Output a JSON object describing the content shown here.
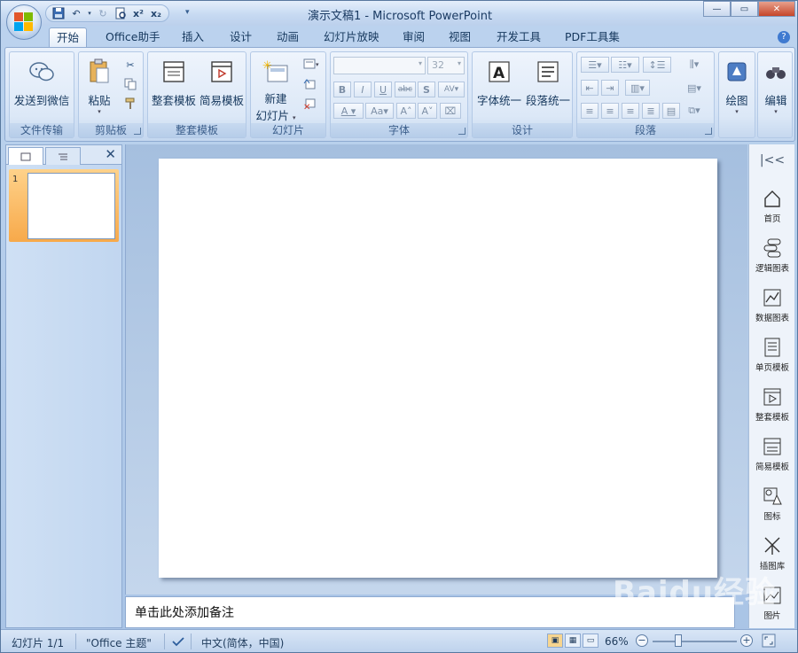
{
  "window": {
    "title": "演示文稿1 - Microsoft PowerPoint",
    "controls": [
      "minimize",
      "maximize",
      "close"
    ]
  },
  "quick_access": {
    "icons": [
      "save-icon",
      "undo-icon",
      "redo-icon",
      "print-preview-icon",
      "superscript-icon",
      "subscript-icon",
      "customize-icon"
    ]
  },
  "tabs": [
    "开始",
    "Office助手",
    "插入",
    "设计",
    "动画",
    "幻灯片放映",
    "审阅",
    "视图",
    "开发工具",
    "PDF工具集"
  ],
  "active_tab": "开始",
  "ribbon": {
    "groups": {
      "file_transfer": {
        "label": "文件传输",
        "send_wechat": "发送到微信"
      },
      "clipboard": {
        "label": "剪贴板",
        "paste": "粘贴"
      },
      "templates": {
        "label": "整套模板",
        "full_template": "整套模板",
        "simple_template": "简易模板"
      },
      "slides": {
        "label": "幻灯片",
        "new_slide_line1": "新建",
        "new_slide_line2": "幻灯片"
      },
      "font": {
        "label": "字体",
        "font_size": "32"
      },
      "design": {
        "label": "设计",
        "font_unify": "字体统一",
        "para_unify": "段落统一"
      },
      "paragraph": {
        "label": "段落"
      },
      "drawing": {
        "label": "绘图"
      },
      "editing": {
        "label": "编辑"
      }
    }
  },
  "slide_panel": {
    "slide_number": "1"
  },
  "notes": {
    "placeholder": "单击此处添加备注"
  },
  "right_sidebar": {
    "items": [
      "首页",
      "逻辑图表",
      "数据图表",
      "单页模板",
      "整套模板",
      "简易模板",
      "图标",
      "插图库",
      "图片"
    ]
  },
  "status": {
    "slide": "幻灯片 1/1",
    "theme": "\"Office 主题\"",
    "language": "中文(简体，中国)",
    "zoom": "66%"
  },
  "watermark": "Baidu经验"
}
